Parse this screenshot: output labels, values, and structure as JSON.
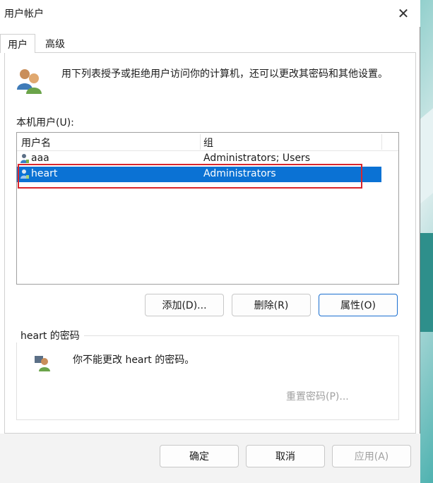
{
  "window": {
    "title": "用户帐户",
    "close_glyph": "✕"
  },
  "tabs": [
    {
      "label": "用户",
      "active": true
    },
    {
      "label": "高级",
      "active": false
    }
  ],
  "intro": {
    "text": "用下列表授予或拒绝用户访问你的计算机，还可以更改其密码和其他设置。"
  },
  "local_users": {
    "label": "本机用户(U):",
    "columns": [
      "用户名",
      "组"
    ],
    "rows": [
      {
        "name": "aaa",
        "group": "Administrators; Users",
        "selected": false
      },
      {
        "name": "heart",
        "group": "Administrators",
        "selected": true
      }
    ],
    "selection_color": "#0b72d4",
    "highlight_color": "#d9262c"
  },
  "user_buttons": {
    "add": "添加(D)...",
    "remove": "删除(R)",
    "properties": "属性(O)"
  },
  "password_section": {
    "legend": "heart 的密码",
    "message": "你不能更改 heart 的密码。",
    "reset_button": "重置密码(P)..."
  },
  "footer_buttons": {
    "ok": "确定",
    "cancel": "取消",
    "apply": "应用(A)"
  },
  "icons": {
    "users": "users-icon",
    "user": "user-icon",
    "password_user": "user-key-icon"
  }
}
